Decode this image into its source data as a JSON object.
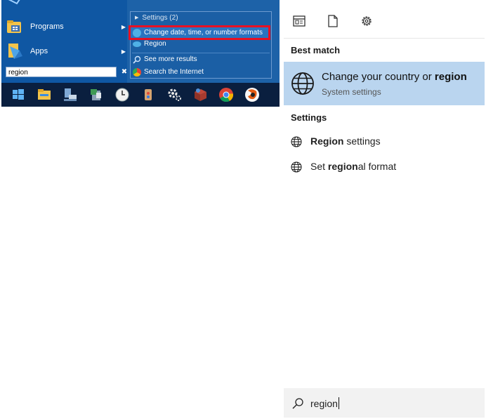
{
  "start_menu": {
    "items": [
      {
        "label": "Programs",
        "icon": "programs-folder-icon"
      },
      {
        "label": "Apps",
        "icon": "apps-icon"
      }
    ],
    "search_value": "region",
    "clear_glyph": "✖",
    "results": {
      "header": "Settings (2)",
      "highlighted": "Change date, time, or number formats",
      "second": "Region",
      "see_more": "See more results",
      "search_internet": "Search the Internet"
    },
    "taskbar_icons": [
      "windows-start-icon",
      "file-explorer-icon",
      "network-icon",
      "recycle-icon",
      "clock-icon",
      "paint-icon",
      "gear-icon",
      "package-icon",
      "chrome-icon",
      "firefox-icon"
    ]
  },
  "win10_search": {
    "filter_icons": [
      "apps-filter-icon",
      "documents-filter-icon",
      "settings-filter-icon"
    ],
    "best_match_heading": "Best match",
    "best_match": {
      "title_prefix": "Change your country or ",
      "title_bold": "region",
      "subtitle": "System settings"
    },
    "settings_heading": "Settings",
    "settings_items": [
      {
        "bold": "Region",
        "rest": " settings",
        "prefix": ""
      },
      {
        "prefix": "Set ",
        "bold": "region",
        "rest": "al format"
      }
    ],
    "search_value": "region"
  },
  "colors": {
    "start_menu_bg": "#1d62a8",
    "highlight_border": "#e81123",
    "best_match_bg": "#bad5ef",
    "taskbar_bg": "#0a1f3f"
  }
}
